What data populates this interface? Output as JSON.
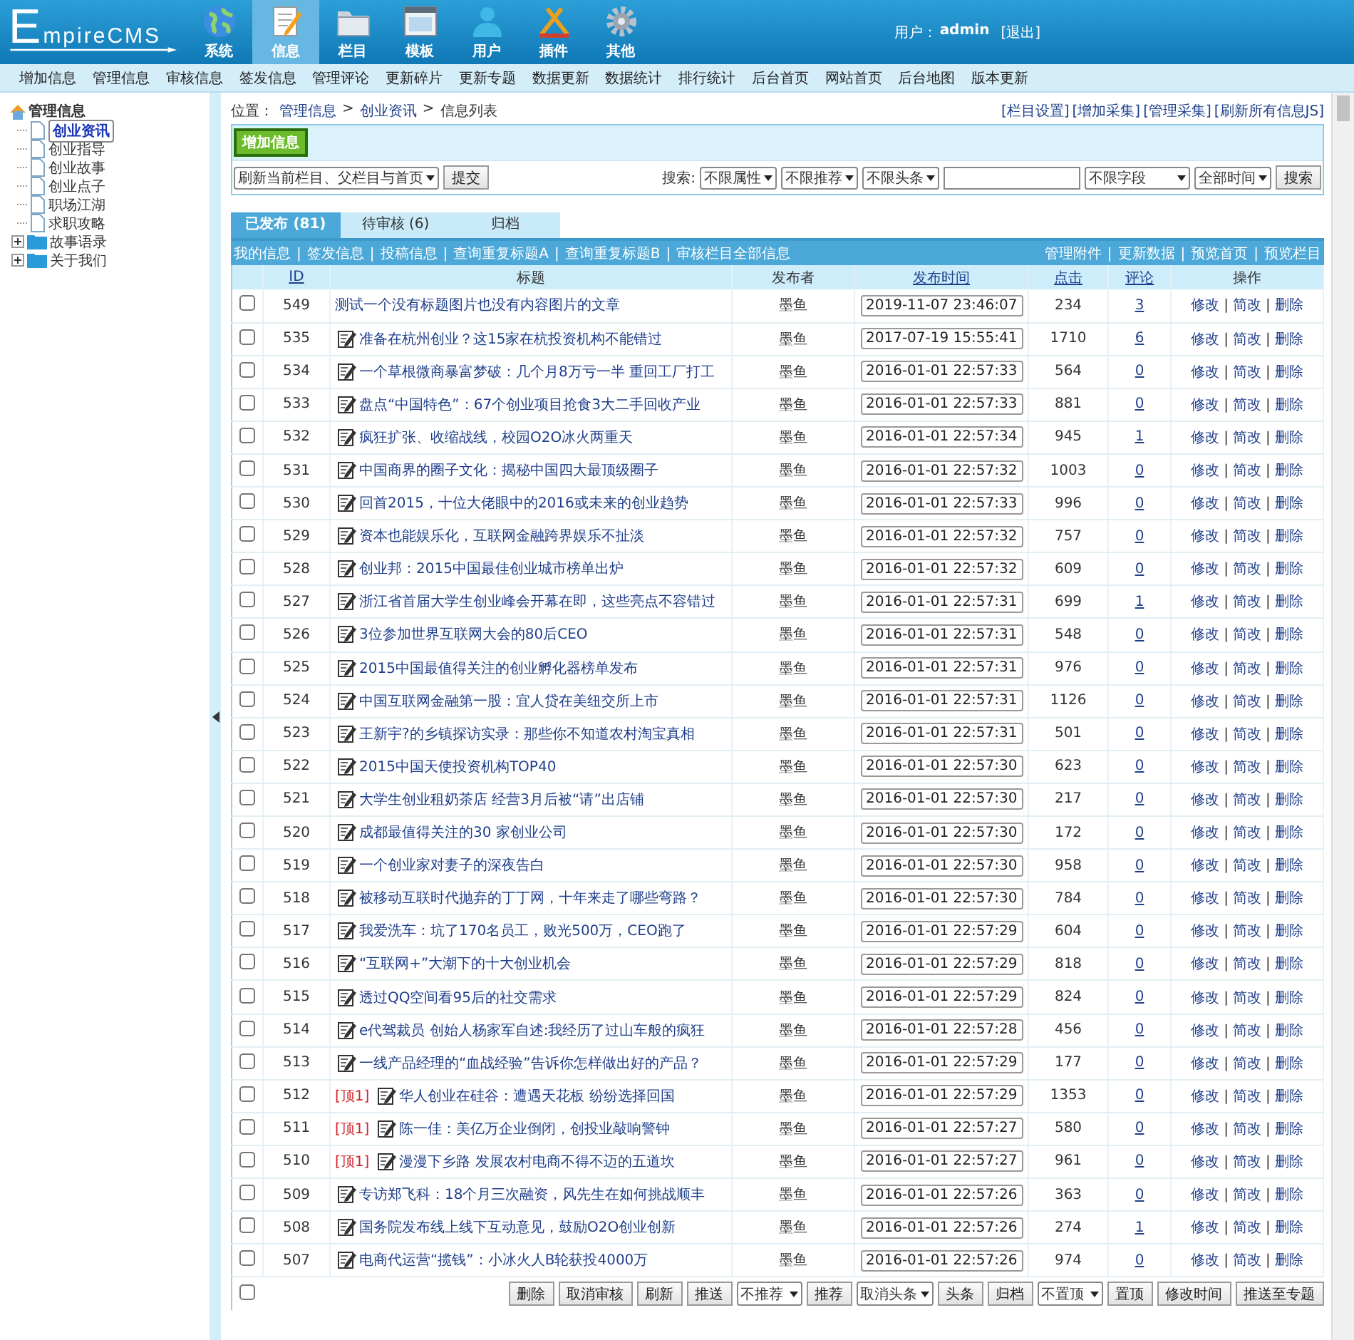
{
  "header": {
    "logo": "EmpireCMS",
    "nav": [
      {
        "label": "系统",
        "selected": false
      },
      {
        "label": "信息",
        "selected": true
      },
      {
        "label": "栏目",
        "selected": false
      },
      {
        "label": "模板",
        "selected": false
      },
      {
        "label": "用户",
        "selected": false
      },
      {
        "label": "插件",
        "selected": false
      },
      {
        "label": "其他",
        "selected": false
      }
    ],
    "user_label": "用户：",
    "user_name": "admin",
    "logout": "[退出]"
  },
  "menu": [
    "增加信息",
    "管理信息",
    "审核信息",
    "签发信息",
    "管理评论",
    "更新碎片",
    "更新专题",
    "数据更新",
    "数据统计",
    "排行统计",
    "后台首页",
    "网站首页",
    "后台地图",
    "版本更新"
  ],
  "sidebar": {
    "root": "管理信息",
    "items": [
      {
        "label": "创业资讯",
        "kind": "page",
        "selected": true
      },
      {
        "label": "创业指导",
        "kind": "page",
        "selected": false
      },
      {
        "label": "创业故事",
        "kind": "page",
        "selected": false
      },
      {
        "label": "创业点子",
        "kind": "page",
        "selected": false
      },
      {
        "label": "职场江湖",
        "kind": "page",
        "selected": false
      },
      {
        "label": "求职攻略",
        "kind": "page",
        "selected": false
      },
      {
        "label": "故事语录",
        "kind": "folder",
        "expanded": false,
        "selected": false
      },
      {
        "label": "关于我们",
        "kind": "folder",
        "expanded": false,
        "selected": false
      }
    ]
  },
  "breadcrumb": {
    "label": "位置：",
    "separator": ">",
    "items": [
      "管理信息",
      "创业资讯",
      "信息列表"
    ]
  },
  "top_links": [
    "[栏目设置]",
    "[增加采集]",
    "[管理采集]",
    "[刷新所有信息JS]"
  ],
  "toolbar": {
    "add_button": "增加信息",
    "refresh_select": "刷新当前栏目、父栏目与首页",
    "submit_button": "提交",
    "search_label": "搜索:",
    "filters": [
      "不限属性",
      "不限推荐",
      "不限头条"
    ],
    "field_select": "不限字段",
    "time_select": "全部时间",
    "search_button": "搜索"
  },
  "tabs": [
    {
      "label": "已发布 (81)",
      "selected": true
    },
    {
      "label": "待审核 (6)",
      "selected": false
    },
    {
      "label": "归档",
      "selected": false
    }
  ],
  "link_bar": {
    "separator": "|",
    "left": [
      "我的信息",
      "签发信息",
      "投稿信息",
      "查询重复标题A",
      "查询重复标题B",
      "审核栏目全部信息"
    ],
    "right": [
      "管理附件",
      "更新数据",
      "预览首页",
      "预览栏目"
    ]
  },
  "table": {
    "columns": [
      {
        "label": "ID",
        "sortable": true
      },
      {
        "label": "标题",
        "sortable": false
      },
      {
        "label": "发布者",
        "sortable": false
      },
      {
        "label": "发布时间",
        "sortable": true
      },
      {
        "label": "点击",
        "sortable": true
      },
      {
        "label": "评论",
        "sortable": true
      },
      {
        "label": "操作",
        "sortable": false
      }
    ],
    "rows": [
      {
        "id": "549",
        "title": "测试一个没有标题图片也没有内容图片的文章",
        "has_icon": false,
        "author": "墨鱼",
        "time": "2019-11-07 23:46:07",
        "clicks": "234",
        "comments": "3",
        "actions": [
          "修改",
          "简改",
          "删除"
        ],
        "checked": false
      },
      {
        "id": "535",
        "title": "准备在杭州创业？这15家在杭投资机构不能错过",
        "has_icon": true,
        "author": "墨鱼",
        "time": "2017-07-19 15:55:41",
        "clicks": "1710",
        "comments": "6",
        "actions": [
          "修改",
          "简改",
          "删除"
        ],
        "checked": false
      },
      {
        "id": "534",
        "title": "一个草根微商暴富梦破：几个月8万亏一半 重回工厂打工",
        "has_icon": true,
        "author": "墨鱼",
        "time": "2016-01-01 22:57:33",
        "clicks": "564",
        "comments": "0",
        "actions": [
          "修改",
          "简改",
          "删除"
        ],
        "checked": false
      },
      {
        "id": "533",
        "title": "盘点“中国特色”：67个创业项目抢食3大二手回收产业",
        "has_icon": true,
        "author": "墨鱼",
        "time": "2016-01-01 22:57:33",
        "clicks": "881",
        "comments": "0",
        "actions": [
          "修改",
          "简改",
          "删除"
        ],
        "checked": false
      },
      {
        "id": "532",
        "title": "疯狂扩张、收缩战线，校园O2O冰火两重天",
        "has_icon": true,
        "author": "墨鱼",
        "time": "2016-01-01 22:57:34",
        "clicks": "945",
        "comments": "1",
        "actions": [
          "修改",
          "简改",
          "删除"
        ],
        "checked": false
      },
      {
        "id": "531",
        "title": "中国商界的圈子文化：揭秘中国四大最顶级圈子",
        "has_icon": true,
        "author": "墨鱼",
        "time": "2016-01-01 22:57:32",
        "clicks": "1003",
        "comments": "0",
        "actions": [
          "修改",
          "简改",
          "删除"
        ],
        "checked": false
      },
      {
        "id": "530",
        "title": "回首2015，十位大佬眼中的2016或未来的创业趋势",
        "has_icon": true,
        "author": "墨鱼",
        "time": "2016-01-01 22:57:33",
        "clicks": "996",
        "comments": "0",
        "actions": [
          "修改",
          "简改",
          "删除"
        ],
        "checked": false
      },
      {
        "id": "529",
        "title": "资本也能娱乐化，互联网金融跨界娱乐不扯淡",
        "has_icon": true,
        "author": "墨鱼",
        "time": "2016-01-01 22:57:32",
        "clicks": "757",
        "comments": "0",
        "actions": [
          "修改",
          "简改",
          "删除"
        ],
        "checked": false
      },
      {
        "id": "528",
        "title": "创业邦：2015中国最佳创业城市榜单出炉",
        "has_icon": true,
        "author": "墨鱼",
        "time": "2016-01-01 22:57:32",
        "clicks": "609",
        "comments": "0",
        "actions": [
          "修改",
          "简改",
          "删除"
        ],
        "checked": false
      },
      {
        "id": "527",
        "title": "浙江省首届大学生创业峰会开幕在即，这些亮点不容错过",
        "has_icon": true,
        "author": "墨鱼",
        "time": "2016-01-01 22:57:31",
        "clicks": "699",
        "comments": "1",
        "actions": [
          "修改",
          "简改",
          "删除"
        ],
        "checked": false
      },
      {
        "id": "526",
        "title": "3位参加世界互联网大会的80后CEO",
        "has_icon": true,
        "author": "墨鱼",
        "time": "2016-01-01 22:57:31",
        "clicks": "548",
        "comments": "0",
        "actions": [
          "修改",
          "简改",
          "删除"
        ],
        "checked": false
      },
      {
        "id": "525",
        "title": "2015中国最值得关注的创业孵化器榜单发布",
        "has_icon": true,
        "author": "墨鱼",
        "time": "2016-01-01 22:57:31",
        "clicks": "976",
        "comments": "0",
        "actions": [
          "修改",
          "简改",
          "删除"
        ],
        "checked": false
      },
      {
        "id": "524",
        "title": "中国互联网金融第一股：宜人贷在美纽交所上市",
        "has_icon": true,
        "author": "墨鱼",
        "time": "2016-01-01 22:57:31",
        "clicks": "1126",
        "comments": "0",
        "actions": [
          "修改",
          "简改",
          "删除"
        ],
        "checked": false
      },
      {
        "id": "523",
        "title": "王新宇?的乡镇探访实录：那些你不知道农村淘宝真相",
        "has_icon": true,
        "author": "墨鱼",
        "time": "2016-01-01 22:57:31",
        "clicks": "501",
        "comments": "0",
        "actions": [
          "修改",
          "简改",
          "删除"
        ],
        "checked": false
      },
      {
        "id": "522",
        "title": "2015中国天使投资机构TOP40",
        "has_icon": true,
        "author": "墨鱼",
        "time": "2016-01-01 22:57:30",
        "clicks": "623",
        "comments": "0",
        "actions": [
          "修改",
          "简改",
          "删除"
        ],
        "checked": false
      },
      {
        "id": "521",
        "title": "大学生创业租奶茶店 经营3月后被“请”出店铺",
        "has_icon": true,
        "author": "墨鱼",
        "time": "2016-01-01 22:57:30",
        "clicks": "217",
        "comments": "0",
        "actions": [
          "修改",
          "简改",
          "删除"
        ],
        "checked": false
      },
      {
        "id": "520",
        "title": "成都最值得关注的30 家创业公司",
        "has_icon": true,
        "author": "墨鱼",
        "time": "2016-01-01 22:57:30",
        "clicks": "172",
        "comments": "0",
        "actions": [
          "修改",
          "简改",
          "删除"
        ],
        "checked": false
      },
      {
        "id": "519",
        "title": "一个创业家对妻子的深夜告白",
        "has_icon": true,
        "author": "墨鱼",
        "time": "2016-01-01 22:57:30",
        "clicks": "958",
        "comments": "0",
        "actions": [
          "修改",
          "简改",
          "删除"
        ],
        "checked": false
      },
      {
        "id": "518",
        "title": "被移动互联时代抛弃的丁丁网，十年来走了哪些弯路？",
        "has_icon": true,
        "author": "墨鱼",
        "time": "2016-01-01 22:57:30",
        "clicks": "784",
        "comments": "0",
        "actions": [
          "修改",
          "简改",
          "删除"
        ],
        "checked": false
      },
      {
        "id": "517",
        "title": "我爱洗车：坑了170名员工，败光500万，CEO跑了",
        "has_icon": true,
        "author": "墨鱼",
        "time": "2016-01-01 22:57:29",
        "clicks": "604",
        "comments": "0",
        "actions": [
          "修改",
          "简改",
          "删除"
        ],
        "checked": false
      },
      {
        "id": "516",
        "title": "“互联网+”大潮下的十大创业机会",
        "has_icon": true,
        "author": "墨鱼",
        "time": "2016-01-01 22:57:29",
        "clicks": "818",
        "comments": "0",
        "actions": [
          "修改",
          "简改",
          "删除"
        ],
        "checked": false
      },
      {
        "id": "515",
        "title": "透过QQ空间看95后的社交需求",
        "has_icon": true,
        "author": "墨鱼",
        "time": "2016-01-01 22:57:29",
        "clicks": "824",
        "comments": "0",
        "actions": [
          "修改",
          "简改",
          "删除"
        ],
        "checked": false
      },
      {
        "id": "514",
        "title": "e代驾裁员 创始人杨家军自述:我经历了过山车般的疯狂",
        "has_icon": true,
        "author": "墨鱼",
        "time": "2016-01-01 22:57:28",
        "clicks": "456",
        "comments": "0",
        "actions": [
          "修改",
          "简改",
          "删除"
        ],
        "checked": false
      },
      {
        "id": "513",
        "title": "一线产品经理的“血战经验”告诉你怎样做出好的产品？",
        "has_icon": true,
        "author": "墨鱼",
        "time": "2016-01-01 22:57:29",
        "clicks": "177",
        "comments": "0",
        "actions": [
          "修改",
          "简改",
          "删除"
        ],
        "checked": false
      },
      {
        "id": "512",
        "title": "华人创业在硅谷：遭遇天花板 纷纷选择回国",
        "has_icon": true,
        "top": "[顶1]",
        "author": "墨鱼",
        "time": "2016-01-01 22:57:29",
        "clicks": "1353",
        "comments": "0",
        "actions": [
          "修改",
          "简改",
          "删除"
        ],
        "checked": false
      },
      {
        "id": "511",
        "title": "陈一佳：美亿万企业倒闭，创投业敲响警钟",
        "has_icon": true,
        "top": "[顶1]",
        "author": "墨鱼",
        "time": "2016-01-01 22:57:27",
        "clicks": "580",
        "comments": "0",
        "actions": [
          "修改",
          "简改",
          "删除"
        ],
        "checked": false
      },
      {
        "id": "510",
        "title": "漫漫下乡路 发展农村电商不得不迈的五道坎",
        "has_icon": true,
        "top": "[顶1]",
        "author": "墨鱼",
        "time": "2016-01-01 22:57:27",
        "clicks": "961",
        "comments": "0",
        "actions": [
          "修改",
          "简改",
          "删除"
        ],
        "checked": false
      },
      {
        "id": "509",
        "title": "专访郑飞科：18个月三次融资，风先生在如何挑战顺丰",
        "has_icon": true,
        "author": "墨鱼",
        "time": "2016-01-01 22:57:26",
        "clicks": "363",
        "comments": "0",
        "actions": [
          "修改",
          "简改",
          "删除"
        ],
        "checked": false
      },
      {
        "id": "508",
        "title": "国务院发布线上线下互动意见，鼓励O2O创业创新",
        "has_icon": true,
        "author": "墨鱼",
        "time": "2016-01-01 22:57:26",
        "clicks": "274",
        "comments": "1",
        "actions": [
          "修改",
          "简改",
          "删除"
        ],
        "checked": false
      },
      {
        "id": "507",
        "title": "电商代运营“揽钱”：小冰火人B轮获投4000万",
        "has_icon": true,
        "author": "墨鱼",
        "time": "2016-01-01 22:57:26",
        "clicks": "974",
        "comments": "0",
        "actions": [
          "修改",
          "简改",
          "删除"
        ],
        "checked": false
      }
    ]
  },
  "footer": {
    "select_all": false,
    "controls": [
      {
        "kind": "button",
        "label": "删除"
      },
      {
        "kind": "button",
        "label": "取消审核"
      },
      {
        "kind": "button",
        "label": "刷新"
      },
      {
        "kind": "button",
        "label": "推送"
      },
      {
        "kind": "select",
        "label": "不推荐"
      },
      {
        "kind": "button",
        "label": "推荐"
      },
      {
        "kind": "select",
        "label": "取消头条"
      },
      {
        "kind": "button",
        "label": "头条"
      },
      {
        "kind": "button",
        "label": "归档"
      },
      {
        "kind": "select",
        "label": "不置顶"
      },
      {
        "kind": "button",
        "label": "置顶"
      },
      {
        "kind": "button",
        "label": "修改时间"
      },
      {
        "kind": "button",
        "label": "推送至专题"
      }
    ]
  }
}
